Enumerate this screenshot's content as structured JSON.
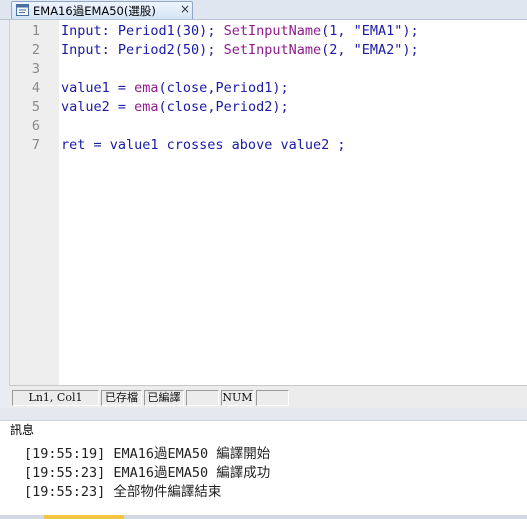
{
  "tab": {
    "icon": "script-file-icon",
    "title": "EMA16過EMA50(選股)",
    "close": "×"
  },
  "editor": {
    "line_numbers": [
      "1",
      "2",
      "3",
      "4",
      "5",
      "6",
      "7"
    ],
    "lines": {
      "l1": {
        "kw": "Input:",
        "a": " Period1(30); ",
        "fn": "SetInputName",
        "b": "(1, ",
        "s": "\"EMA1\"",
        "c": ");"
      },
      "l2": {
        "kw": "Input:",
        "a": " Period2(50); ",
        "fn": "SetInputName",
        "b": "(2, ",
        "s": "\"EMA2\"",
        "c": ");"
      },
      "l4": {
        "a": "value1 = ",
        "fn": "ema",
        "b": "(close,Period1);"
      },
      "l5": {
        "a": "value2 = ",
        "fn": "ema",
        "b": "(close,Period2);"
      },
      "l7": {
        "a": "ret = value1 crosses above value2 ;"
      }
    }
  },
  "status": {
    "position": "Ln1, Col1",
    "saved": "已存檔",
    "compiled": "已編譯",
    "blank1": "",
    "num": "NUM",
    "blank2": ""
  },
  "output": {
    "header": "訊息",
    "messages": [
      "[19:55:19] EMA16過EMA50 編譯開始",
      "[19:55:23] EMA16過EMA50 編譯成功",
      "[19:55:23] 全部物件編譯結束"
    ]
  }
}
